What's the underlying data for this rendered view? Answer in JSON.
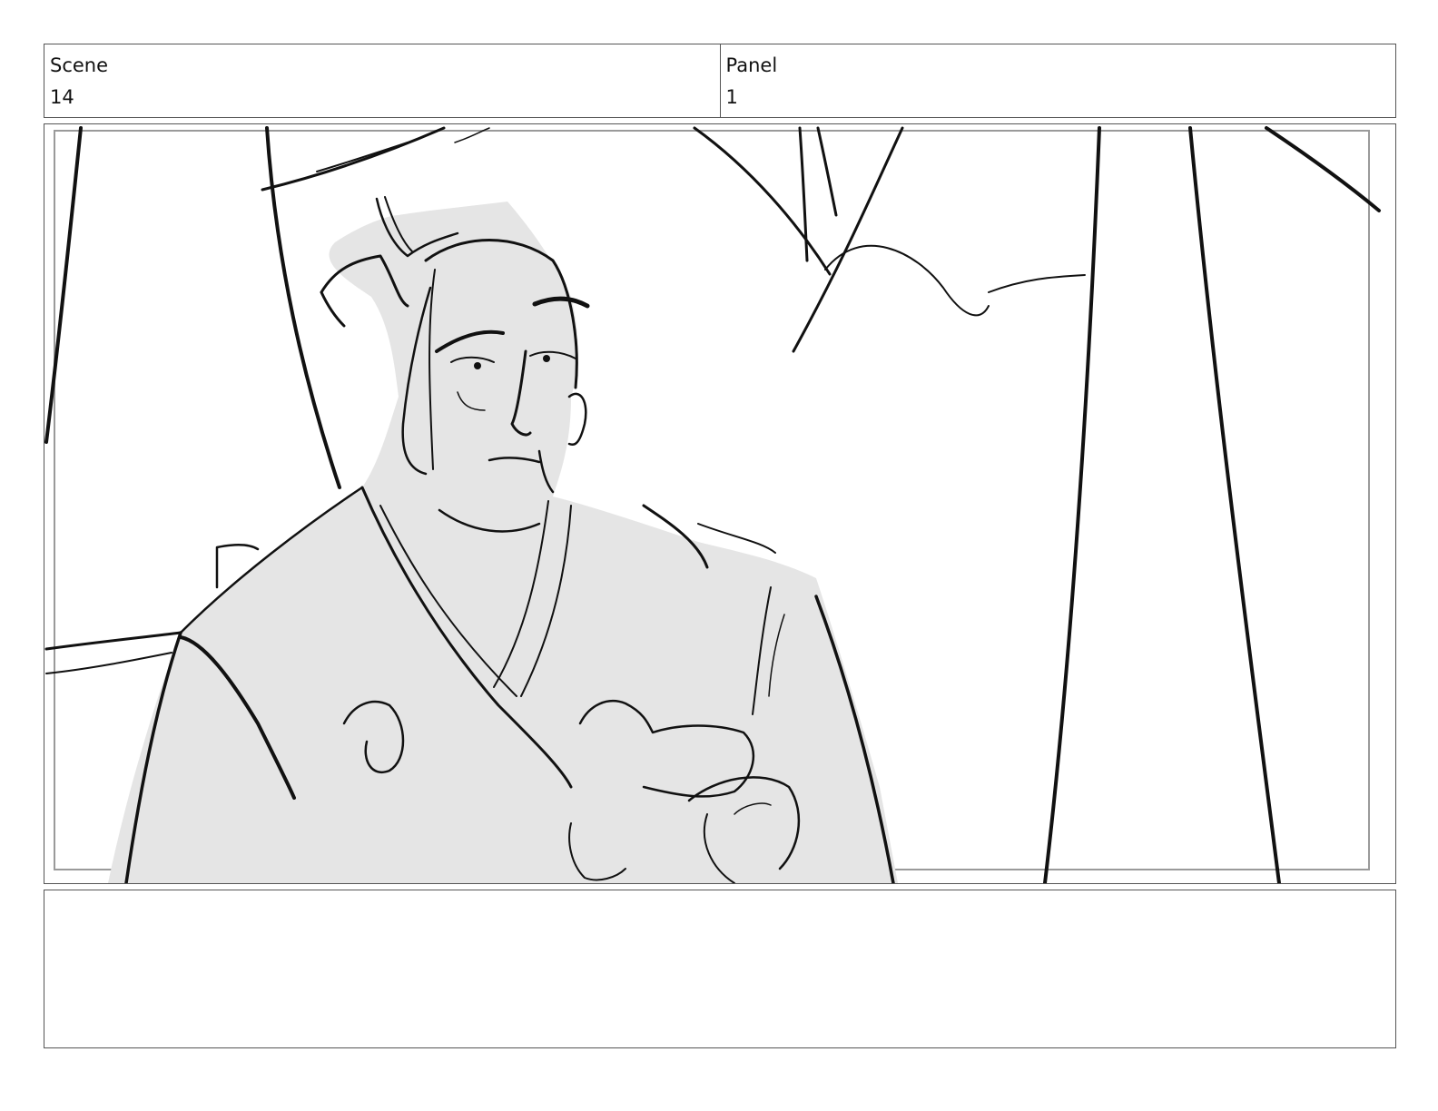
{
  "header": {
    "scene_label": "Scene",
    "scene_value": "14",
    "panel_label": "Panel",
    "panel_value": "1"
  },
  "panel": {
    "drawing": "storyboard-sketch",
    "fill_color": "#e5e5e5",
    "line_color": "#111111"
  },
  "notes": {
    "text": ""
  }
}
